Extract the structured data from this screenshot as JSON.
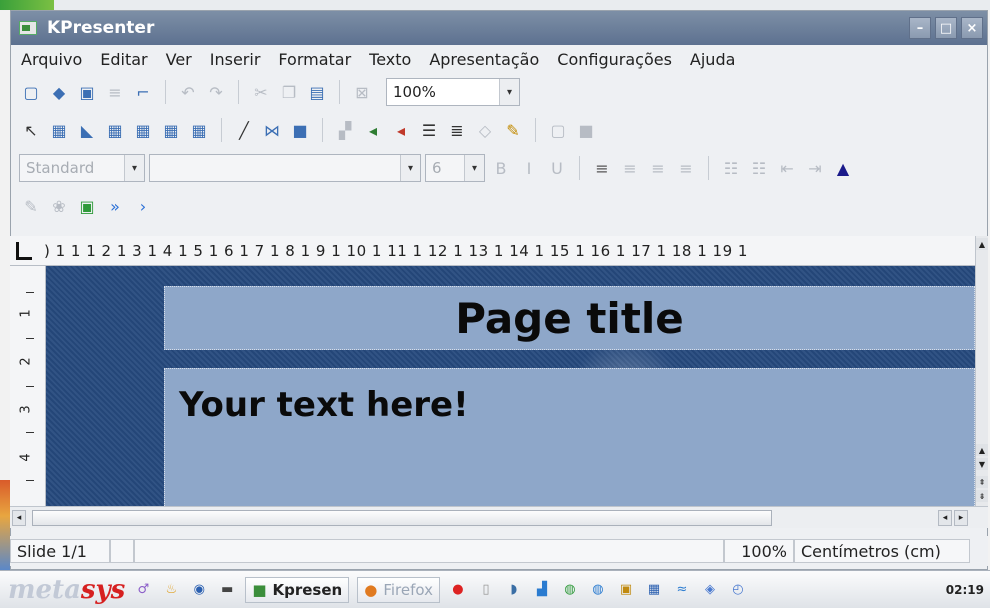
{
  "window": {
    "title": "KPresenter"
  },
  "menu": [
    "Arquivo",
    "Editar",
    "Ver",
    "Inserir",
    "Formatar",
    "Texto",
    "Apresentação",
    "Configurações",
    "Ajuda"
  ],
  "toolbar": {
    "zoom": "100%",
    "style": "Standard",
    "font_size": "6",
    "bold": "B",
    "italic": "I",
    "underline": "U"
  },
  "ruler": {
    "scale": ")  1  1  1  2  1  3  1  4  1  5  1  6  1  7  1  8  1  9  1 10  1 11  1 12  1 13  1 14  1 15  1 16  1 17  1 18  1 19  1"
  },
  "vruler": [
    "1",
    "2",
    "3",
    "4"
  ],
  "slide": {
    "title": "Page title",
    "body": "Your text here!"
  },
  "status": {
    "slide": "Slide 1/1",
    "zoom": "100%",
    "unit": "Centímetros (cm)"
  },
  "taskbar": {
    "brand_pre": "meta",
    "brand_post": "sys",
    "kpresenter": "Kpresen",
    "firefox": "Firefox",
    "clock": "02:19"
  }
}
